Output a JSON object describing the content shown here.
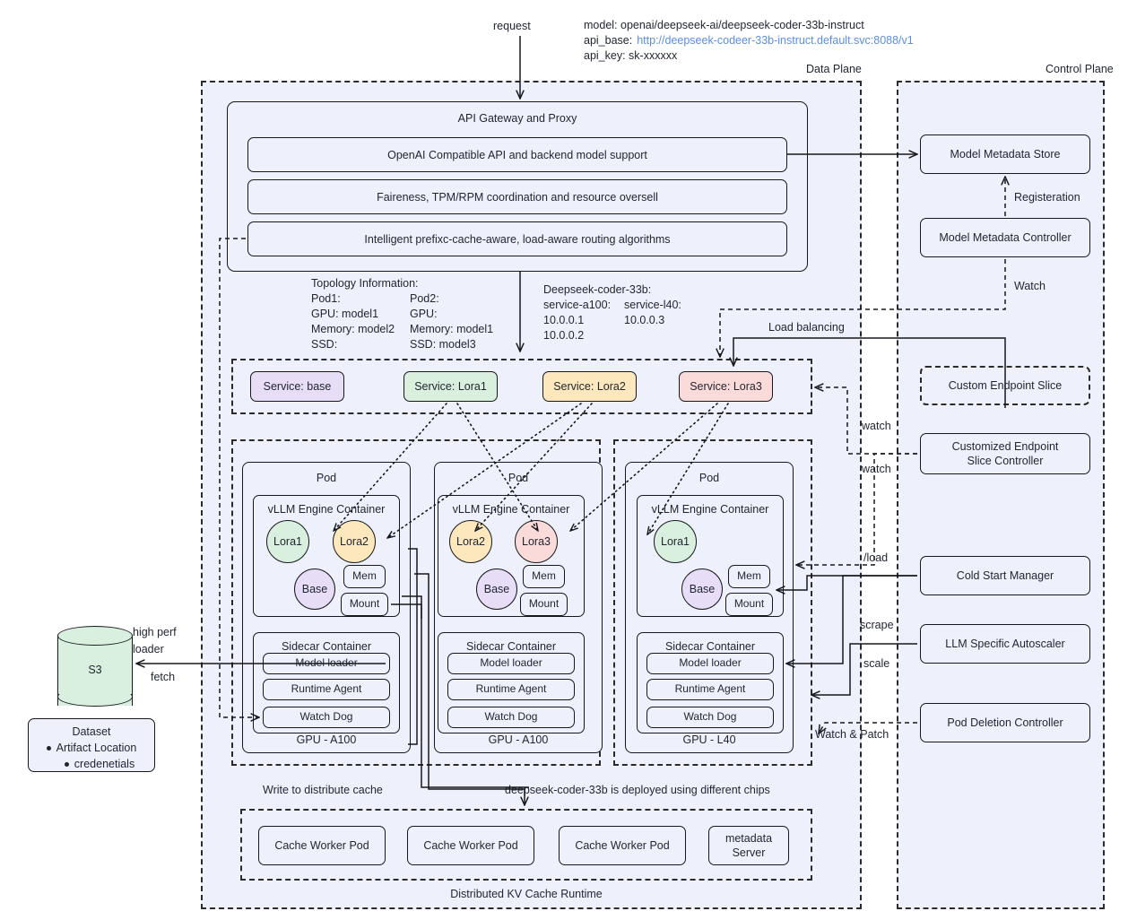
{
  "request": {
    "label": "request"
  },
  "config": {
    "model_line": "model: openai/deepseek-ai/deepseek-coder-33b-instruct",
    "api_base_label": "api_base:",
    "api_base_value": "http://deepseek-codeer-33b-instruct.default.svc:8088/v1",
    "api_key_line": "api_key: sk-xxxxxx"
  },
  "planes": {
    "data_plane_label": "Data Plane",
    "control_plane_label": "Control Plane"
  },
  "gateway": {
    "title": "API Gateway and Proxy",
    "rows": [
      "OpenAI Compatible API and backend model support",
      "Faireness, TPM/RPM coordination and resource oversell",
      "Intelligent prefixc-cache-aware, load-aware  routing algorithms"
    ]
  },
  "topology": {
    "title": "Topology Information:",
    "col1": [
      "Pod1:",
      "GPU: model1",
      "Memory: model2",
      "SSD:"
    ],
    "col2": [
      "Pod2:",
      "GPU:",
      "Memory: model1",
      "SSD: model3"
    ]
  },
  "endpoints": {
    "title": "Deepseek-coder-33b:",
    "col1": [
      "service-a100:",
      "10.0.0.1",
      "10.0.0.2"
    ],
    "col2": [
      "service-l40:",
      "10.0.0.3"
    ]
  },
  "services": [
    {
      "label": "Service: base",
      "color": "#e8ddf7"
    },
    {
      "label": "Service: Lora1",
      "color": "#d9f0df"
    },
    {
      "label": "Service: Lora2",
      "color": "#fde8bd"
    },
    {
      "label": "Service: Lora3",
      "color": "#fbdada"
    }
  ],
  "pods": [
    {
      "title": "Pod",
      "engine_title": "vLLM Engine Container",
      "circles": [
        {
          "label": "Lora1",
          "color": "#d9f0df"
        },
        {
          "label": "Lora2",
          "color": "#fde8bd"
        },
        {
          "label": "Base",
          "color": "#e8ddf7"
        }
      ],
      "chips": [
        "Mem",
        "Mount"
      ],
      "sidecar_title": "Sidecar Container",
      "sidecar_rows": [
        "Model loader",
        "Runtime Agent",
        "Watch Dog"
      ],
      "gpu": "GPU - A100"
    },
    {
      "title": "Pod",
      "engine_title": "vLLM Engine Container",
      "circles": [
        {
          "label": "Lora2",
          "color": "#fde8bd"
        },
        {
          "label": "Lora3",
          "color": "#fbdada"
        },
        {
          "label": "Base",
          "color": "#e8ddf7"
        }
      ],
      "chips": [
        "Mem",
        "Mount"
      ],
      "sidecar_title": "Sidecar Container",
      "sidecar_rows": [
        "Model loader",
        "Runtime Agent",
        "Watch Dog"
      ],
      "gpu": "GPU - A100"
    },
    {
      "title": "Pod",
      "engine_title": "vLLM Engine Container",
      "circles": [
        {
          "label": "Lora1",
          "color": "#d9f0df"
        },
        {
          "label": "Base",
          "color": "#e8ddf7"
        }
      ],
      "chips": [
        "Mem",
        "Mount"
      ],
      "sidecar_title": "Sidecar Container",
      "sidecar_rows": [
        "Model loader",
        "Runtime Agent",
        "Watch Dog"
      ],
      "gpu": "GPU - L40"
    }
  ],
  "control": {
    "boxes": [
      "Model Metadata Store",
      "Model Metadata Controller",
      "Custom Endpoint Slice",
      "Customized Endpoint\nSlice Controller",
      "Cold Start Manager",
      "LLM Specific Autoscaler",
      "Pod Deletion Controller"
    ],
    "endpoint_slice_controller_line1": "Customized Endpoint",
    "endpoint_slice_controller_line2": "Slice Controller"
  },
  "edge_labels": {
    "registeration": "Registeration",
    "watch": "Watch",
    "load_balancing": "Load balancing",
    "watch_1": "watch",
    "watch_2": "watch",
    "load": "/load",
    "scrape": "scrape",
    "scale": "scale",
    "watch_and_patch": "Watch & Patch",
    "high_perf_loader_1": "high perf",
    "high_perf_loader_2": "loader",
    "fetch": "fetch",
    "write_to_cache": "Write to distribute cache",
    "chips_note": "deepseek-coder-33b is deployed using different chips"
  },
  "storage": {
    "s3_label": "S3",
    "dataset_title": "Dataset",
    "dataset_items": [
      "Artifact Location",
      "credenetials"
    ]
  },
  "cache": {
    "workers": [
      "Cache Worker Pod",
      "Cache Worker Pod",
      "Cache Worker Pod"
    ],
    "metadata_line1": "metadata",
    "metadata_line2": "Server",
    "runtime_label": "Distributed KV Cache Runtime"
  },
  "colors": {
    "panel_bg": "#eef1fb",
    "stroke": "#16181d",
    "link_blue": "#5b8fdd",
    "green": "#d9f0df",
    "purple": "#e8ddf7",
    "yellow": "#fde8bd",
    "pink": "#fbdada"
  }
}
